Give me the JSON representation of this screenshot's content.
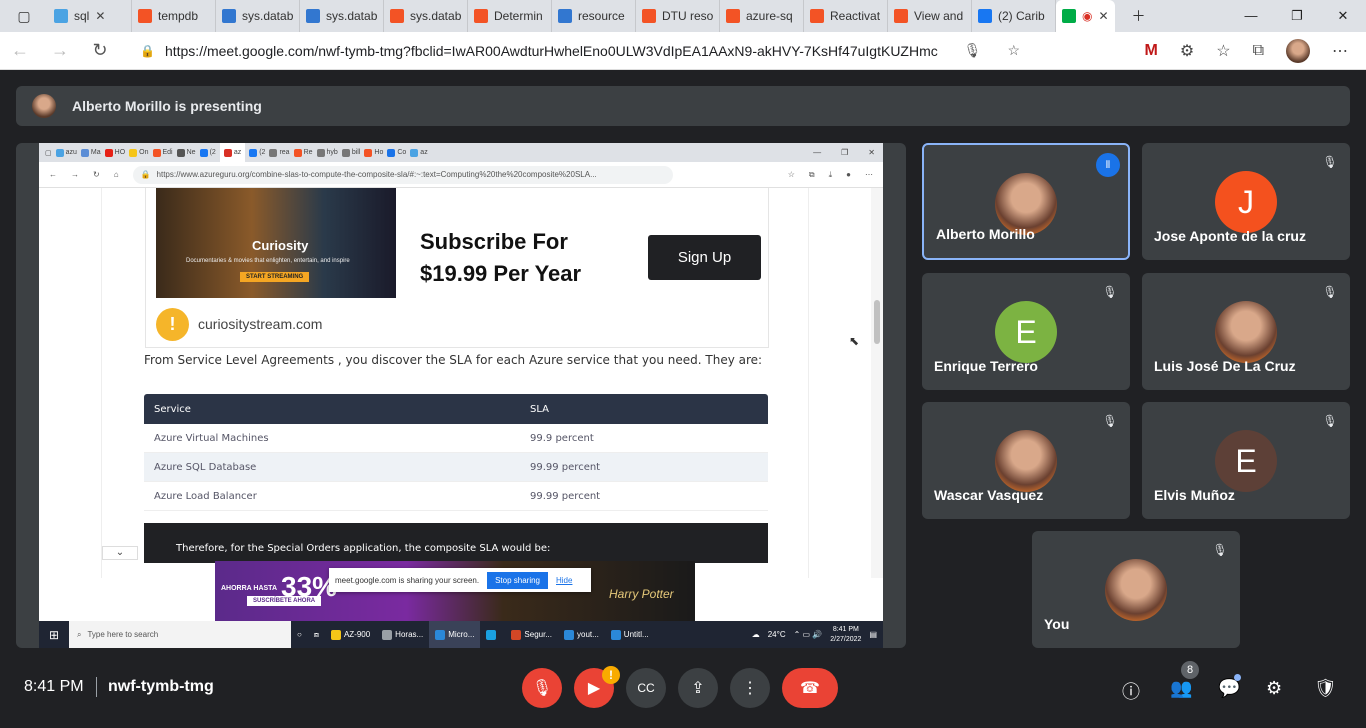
{
  "browser": {
    "tabs": [
      {
        "label": "sql",
        "color": "#4ba3e3"
      },
      {
        "label": "tempdb",
        "color": "#f35325"
      },
      {
        "label": "sys.datab",
        "color": "#3277d0"
      },
      {
        "label": "sys.datab",
        "color": "#3277d0"
      },
      {
        "label": "sys.datab",
        "color": "#f35325"
      },
      {
        "label": "Determin",
        "color": "#f35325"
      },
      {
        "label": "resource",
        "color": "#3277d0"
      },
      {
        "label": "DTU reso",
        "color": "#f35325"
      },
      {
        "label": "azure-sq",
        "color": "#f35325"
      },
      {
        "label": "Reactivat",
        "color": "#f35325"
      },
      {
        "label": "View and",
        "color": "#f35325"
      },
      {
        "label": "(2) Carib",
        "color": "#1877f2"
      }
    ],
    "url": "https://meet.google.com/nwf-tymb-tmg?fbclid=IwAR00AwdturHwhelEno0ULW3VdIpEA1AAxN9-akHVY-7KsHf47uIgtKUZHmc"
  },
  "presenter_bar": {
    "text": "Alberto Morillo is presenting"
  },
  "shared": {
    "tabs": [
      "azu",
      "Ma",
      "HO",
      "On",
      "Edi",
      "Ne",
      "(2",
      "az",
      "(2",
      "rea",
      "Re",
      "hyb",
      "bill",
      "Ho",
      "Co",
      "az"
    ],
    "url": "https://www.azureguru.org/combine-slas-to-compute-the-composite-sla/#:~:text=Computing%20the%20composite%20SLA...",
    "ad": {
      "brand": "Curiosity",
      "tagline": "Documentaries & movies that enlighten, entertain, and inspire",
      "streaming_btn": "START STREAMING",
      "headline_1": "Subscribe For",
      "headline_2": "$19.99 Per Year",
      "signup": "Sign Up",
      "logo_letter": "!",
      "domain": "curiositystream.com"
    },
    "paragraph": "From Service Level Agreements , you discover the SLA for each Azure service that you need. They are:",
    "table": {
      "headers": [
        "Service",
        "SLA"
      ],
      "rows": [
        [
          "Azure Virtual Machines",
          "99.9 percent"
        ],
        [
          "Azure SQL Database",
          "99.99 percent"
        ],
        [
          "Azure Load Balancer",
          "99.99 percent"
        ]
      ]
    },
    "dark_text": "Therefore, for the Special Orders application, the composite SLA would be:",
    "bottom_ad": {
      "ahora": "AHORRA HASTA",
      "pct": "33%",
      "sus": "SUSCRÍBETE AHORA",
      "movie": "Harry Potter"
    },
    "sharing": {
      "text": "meet.google.com is sharing your screen.",
      "stop": "Stop sharing",
      "hide": "Hide"
    },
    "taskbar": {
      "search": "Type here to search",
      "apps": [
        {
          "label": "AZ-900",
          "color": "#f5c518"
        },
        {
          "label": "Horas...",
          "color": "#9aa0a6"
        },
        {
          "label": "Micro...",
          "color": "#2b88d8"
        },
        {
          "label": "",
          "color": "#1aa0e0"
        },
        {
          "label": "Segur...",
          "color": "#d24726"
        },
        {
          "label": "yout...",
          "color": "#2b88d8"
        },
        {
          "label": "Untitl...",
          "color": "#2b88d8"
        }
      ],
      "weather": "24°C",
      "time": "8:41 PM",
      "date": "2/27/2022"
    }
  },
  "participants": [
    {
      "name": "Alberto Morillo",
      "initial": "",
      "color": "",
      "photo": true,
      "speaking": true
    },
    {
      "name": "Jose Aponte de la cruz",
      "initial": "J",
      "color": "#f4511e",
      "photo": false,
      "speaking": false
    },
    {
      "name": "Enrique Terrero",
      "initial": "E",
      "color": "#7cb342",
      "photo": false,
      "speaking": false
    },
    {
      "name": "Luis José De La Cruz",
      "initial": "",
      "color": "",
      "photo": true,
      "speaking": false
    },
    {
      "name": "Wascar Vasquez",
      "initial": "",
      "color": "",
      "photo": true,
      "speaking": false
    },
    {
      "name": "Elvis Muñoz",
      "initial": "E",
      "color": "#5d4037",
      "photo": false,
      "speaking": false
    },
    {
      "name": "You",
      "initial": "",
      "color": "",
      "photo": true,
      "speaking": false
    }
  ],
  "meeting": {
    "time": "8:41 PM",
    "code": "nwf-tymb-tmg",
    "people_count": "8",
    "warn": "!"
  }
}
